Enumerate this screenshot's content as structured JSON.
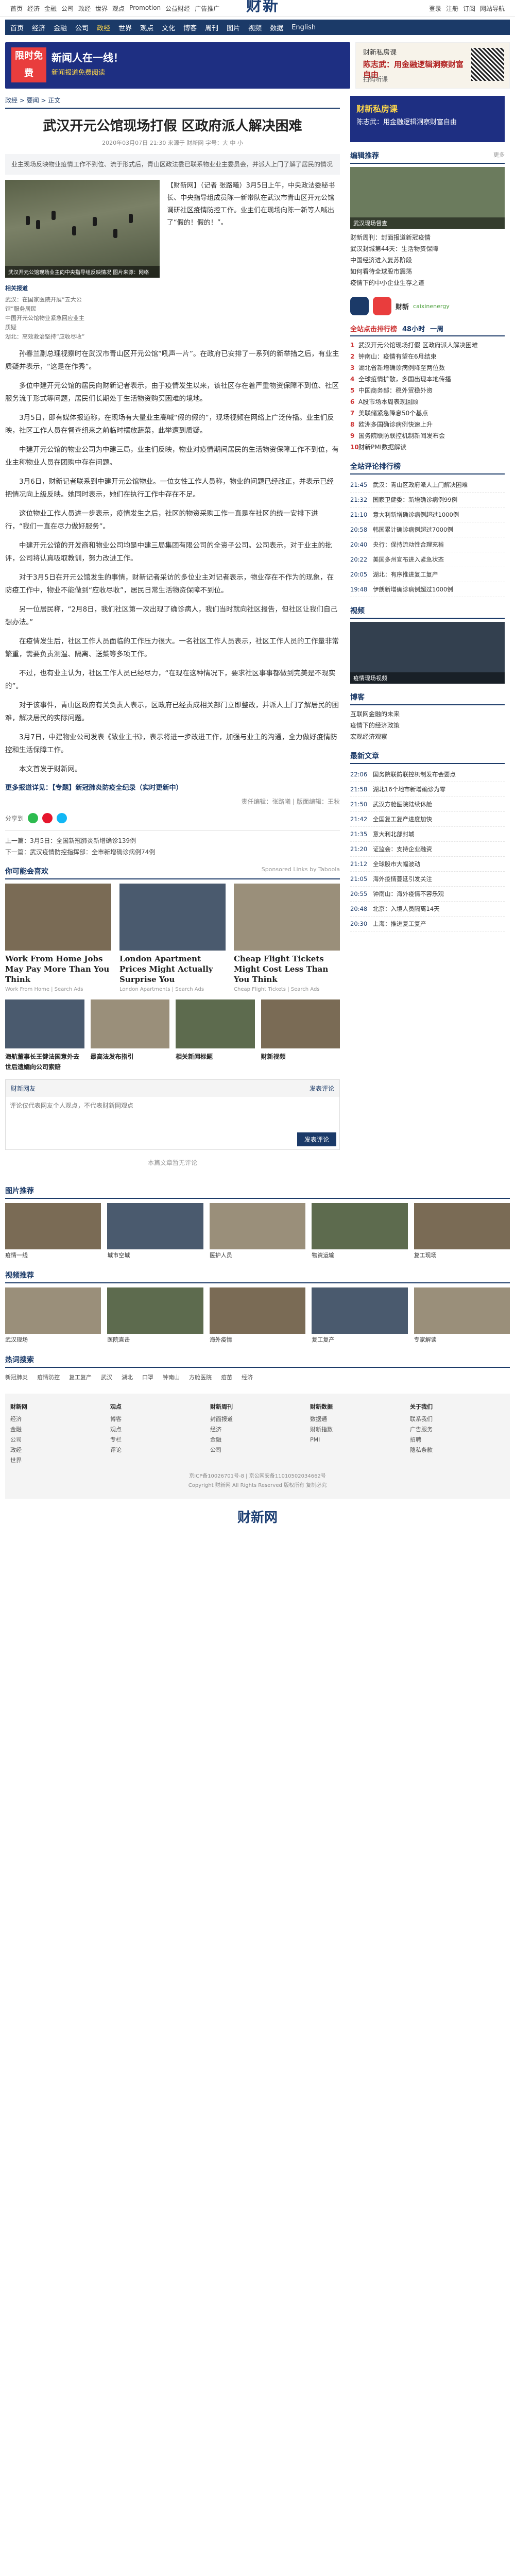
{
  "topbar": {
    "left": [
      "首页",
      "经济",
      "金融",
      "公司",
      "政经",
      "世界",
      "观点",
      "Promotion",
      "公益财经",
      "广告推广"
    ],
    "right": [
      "登录",
      "注册",
      "订阅",
      "网站导航"
    ]
  },
  "logo": {
    "cn": "财新",
    "en": "Caixin"
  },
  "nav": [
    "首页",
    "经济",
    "金融",
    "公司",
    "政经",
    "世界",
    "观点",
    "文化",
    "博客",
    "周刊",
    "图片",
    "视频",
    "数据",
    "English"
  ],
  "nav2": [
    "宏观",
    "科技",
    "地产",
    "汽车",
    "能源",
    "健康",
    "环科",
    "消费",
    "数字说",
    "比较",
    "中国改革",
    "图片",
    "周刊",
    "视频"
  ],
  "ad_top": {
    "badge": "限时免费",
    "title": "新闻人在一线！",
    "sub": "新闻报道免费阅读",
    "side_t1": "财新私房课",
    "side_t2": "陈志武：用金融逻辑洞察财富自由",
    "side_t3": "扫码听课"
  },
  "breadcrumb": {
    "a": "政经",
    "b": "要闻",
    "c": "正文"
  },
  "article": {
    "title": "武汉开元公馆现场打假 区政府派人解决困难",
    "meta": "2020年03月07日 21:30  来源于 财新网  字号：大 中 小",
    "summary": "业主现场反映物业疫情工作不到位、流于形式后，青山区政法委已联系物业业主委员会，并派人上门了解了居民的情况",
    "photo_caption": "武汉开元公馆现场业主向中央指导组反映情况 图片来源：网络",
    "lead": "【财新网】（记者 张路曦）3月5日上午，中央政法委秘书长、中央指导组成员陈一新带队在武汉市青山区开元公馆调研社区疫情防控工作。业主们在现场向陈一新等人喊出了“假的！假的！”。",
    "left_note_hd": "相关报道",
    "left_notes": [
      "武汉：在国家医院开展“五大公馆”服务居民",
      "中国开元公馆物业紧急回应业主质疑",
      "湖北：高效救治坚持“应收尽收”"
    ],
    "paragraphs": [
      "孙春兰副总理视察时在武汉市青山区开元公馆“吼声一片”。在政府已安排了一系列的新举措之后，有业主质疑并表示，“这是在作秀”。",
      "多位中建开元公馆的居民向财新记者表示，由于疫情发生以来，该社区存在着严重物资保障不到位、社区服务流于形式等问题，居民们长期处于生活物资购买困难的境地。",
      "3月5日，即有媒体报道称，在现场有大量业主高喊“假的假的”，现场视频在网络上广泛传播。业主们反映，社区工作人员在督查组来之前临时摆放蔬菜，此举遭到质疑。",
      "中建开元公馆的物业公司为中建三局，业主们反映，物业对疫情期间居民的生活物资保障工作不到位，有业主称物业人员在团购中存在问题。",
      "3月6日，财新记者联系到中建开元公馆物业。一位女性工作人员称，物业的问题已经改正，并表示已经把情况向上级反映。她同时表示，她们在执行工作中存在不足。",
      "这位物业工作人员进一步表示，疫情发生之后，社区的物资采购工作一直是在社区的统一安排下进行，“我们一直在尽力做好服务”。",
      "中建开元公馆的开发商和物业公司均是中建三局集团有限公司的全资子公司。公司表示，对于业主的批评，公司将认真吸取教训，努力改进工作。",
      "对于3月5日在开元公馆发生的事情，财新记者采访的多位业主对记者表示，物业存在不作为的现象，在防疫工作中，物业不能做到“应收尽收”，居民日常生活物资保障不到位。",
      "另一位居民称，“2月8日，我们社区第一次出现了确诊病人，我们当时就向社区报告，但社区让我们自己想办法。”",
      "在疫情发生后，社区工作人员面临的工作压力很大。一名社区工作人员表示，社区工作人员的工作量非常繁重，需要负责测温、隔离、送菜等多项工作。",
      "不过，也有业主认为，社区工作人员已经尽力，“在现在这种情况下，要求社区事事都做到完美是不现实的”。",
      "对于该事件，青山区政府有关负责人表示，区政府已经责成相关部门立即整改，并派人上门了解居民的困难，解决居民的实际问题。",
      "3月7日，中建物业公司发表《致业主书》，表示将进一步改进工作，加强与业主的沟通，全力做好疫情防控和生活保障工作。",
      "本文首发于财新网。"
    ],
    "highlight": "更多报道详见：【专题】新冠肺炎防疫全纪录（实时更新中）",
    "editor": "责任编辑：张路曦 | 版面编辑：王秋"
  },
  "share": {
    "label": "分享到",
    "tags": [
      "微信",
      "微博",
      "QQ"
    ]
  },
  "prevnext": {
    "prev": "上一篇：3月5日：全国新冠肺炎新增确诊139例",
    "next": "下一篇：武汉疫情防控指挥部：全市新增确诊病例74例"
  },
  "recommend": {
    "title": "你可能会喜欢",
    "sub": "Sponsored Links by Taboola",
    "items": [
      {
        "t": "Work From Home Jobs May Pay More Than You Think",
        "s": "Work From Home | Search Ads"
      },
      {
        "t": "London Apartment Prices Might Actually Surprise You",
        "s": "London Apartments | Search Ads"
      },
      {
        "t": "Cheap Flight Tickets Might Cost Less Than You Think",
        "s": "Cheap Flight Tickets | Search Ads"
      }
    ],
    "items2": [
      {
        "t": "海航董事长王健法国意外去世后遗孀向公司索赔",
        "s": "财新网"
      },
      {
        "t": "最高法发布指引",
        "s": "财新网"
      },
      {
        "t": "相关新闻标题",
        "s": "财新网"
      },
      {
        "t": "财新视频",
        "s": "财新网"
      }
    ]
  },
  "comment": {
    "hd": "财新网友",
    "hd_r": "发表评论",
    "placeholder": "评论仅代表网友个人观点，不代表财新网观点",
    "btn": "发表评论",
    "none": "本篇文章暂无评论"
  },
  "right": {
    "ad": {
      "t1": "财新私房课",
      "t2": "陈志武：用金融逻辑洞察财富自由"
    },
    "editor_pick": {
      "hd": "编辑推荐",
      "more": "更多",
      "img_cap": "武汉现场督查",
      "items": [
        "财新周刊：封面报道新冠疫情",
        "武汉封城第44天：生活物资保障",
        "中国经济进入复苏阶段",
        "如何看待全球股市震荡",
        "疫情下的中小企业生存之道"
      ]
    },
    "app": {
      "name": "财新",
      "sub": "caixinenergy"
    },
    "hot": {
      "tabs": [
        "全站点击排行榜",
        "48小时",
        "一周"
      ],
      "items": [
        "武汉开元公馆现场打假 区政府派人解决困难",
        "钟南山：疫情有望在6月结束",
        "湖北省新增确诊病例降至两位数",
        "全球疫情扩散，多国出现本地传播",
        "中国商务部：稳外贸稳外资",
        "A股市场本周表现回顾",
        "美联储紧急降息50个基点",
        "欧洲多国确诊病例快速上升",
        "国务院联防联控机制新闻发布会",
        "财新PMI数据解读"
      ]
    },
    "timeline": {
      "hd": "全站评论排行榜",
      "items": [
        {
          "tm": "21:45",
          "t": "武汉：青山区政府派人上门解决困难"
        },
        {
          "tm": "21:32",
          "t": "国家卫健委：新增确诊病例99例"
        },
        {
          "tm": "21:10",
          "t": "意大利新增确诊病例超过1000例"
        },
        {
          "tm": "20:58",
          "t": "韩国累计确诊病例超过7000例"
        },
        {
          "tm": "20:40",
          "t": "央行：保持流动性合理充裕"
        },
        {
          "tm": "20:22",
          "t": "美国多州宣布进入紧急状态"
        },
        {
          "tm": "20:05",
          "t": "湖北：有序推进复工复产"
        },
        {
          "tm": "19:48",
          "t": "伊朗新增确诊病例超过1000例"
        }
      ]
    },
    "video": {
      "hd": "视频",
      "cap": "疫情现场视频"
    },
    "blog": {
      "hd": "博客",
      "items": [
        "互联网金融的未来",
        "疫情下的经济政策",
        "宏观经济观察"
      ]
    },
    "latest": {
      "hd": "最新文章",
      "items": [
        {
          "tm": "22:06",
          "t": "国务院联防联控机制发布会要点"
        },
        {
          "tm": "21:58",
          "t": "湖北16个地市新增确诊为零"
        },
        {
          "tm": "21:50",
          "t": "武汉方舱医院陆续休舱"
        },
        {
          "tm": "21:42",
          "t": "全国复工复产进度加快"
        },
        {
          "tm": "21:35",
          "t": "意大利北部封城"
        },
        {
          "tm": "21:20",
          "t": "证监会：支持企业融资"
        },
        {
          "tm": "21:12",
          "t": "全球股市大幅波动"
        },
        {
          "tm": "21:05",
          "t": "海外疫情蔓延引发关注"
        },
        {
          "tm": "20:55",
          "t": "钟南山：海外疫情不容乐观"
        },
        {
          "tm": "20:48",
          "t": "北京：入境人员隔离14天"
        },
        {
          "tm": "20:30",
          "t": "上海：推进复工复产"
        }
      ]
    }
  },
  "bottom": {
    "slide_hd": "全媒体矩阵",
    "photo_hd": "图片推荐",
    "photo_items": [
      "疫情一线",
      "城市空城",
      "医护人员",
      "物资运输",
      "复工现场"
    ],
    "video_hd": "视频推荐",
    "video_items": [
      "武汉现场",
      "医院直击",
      "海外疫情",
      "复工复产",
      "专家解读"
    ],
    "hot_hd": "热词搜索",
    "hot_words": [
      "新冠肺炎",
      "疫情防控",
      "复工复产",
      "武汉",
      "湖北",
      "口罩",
      "钟南山",
      "方舱医院",
      "疫苗",
      "经济"
    ]
  },
  "footer": {
    "cols": [
      {
        "h": "财新网",
        "items": [
          "经济",
          "金融",
          "公司",
          "政经",
          "世界"
        ]
      },
      {
        "h": "观点",
        "items": [
          "博客",
          "观点",
          "专栏",
          "评论"
        ]
      },
      {
        "h": "财新周刊",
        "items": [
          "封面报道",
          "经济",
          "金融",
          "公司"
        ]
      },
      {
        "h": "财新数据",
        "items": [
          "数据通",
          "财新指数",
          "PMI"
        ]
      },
      {
        "h": "关于我们",
        "items": [
          "联系我们",
          "广告服务",
          "招聘",
          "隐私条款"
        ]
      }
    ],
    "copy1": "京ICP备10026701号-8 | 京公网安备11010502034662号",
    "copy2": "Copyright 财新网 All Rights Reserved 版权所有 复制必究",
    "bottom_logo": "财新网"
  }
}
